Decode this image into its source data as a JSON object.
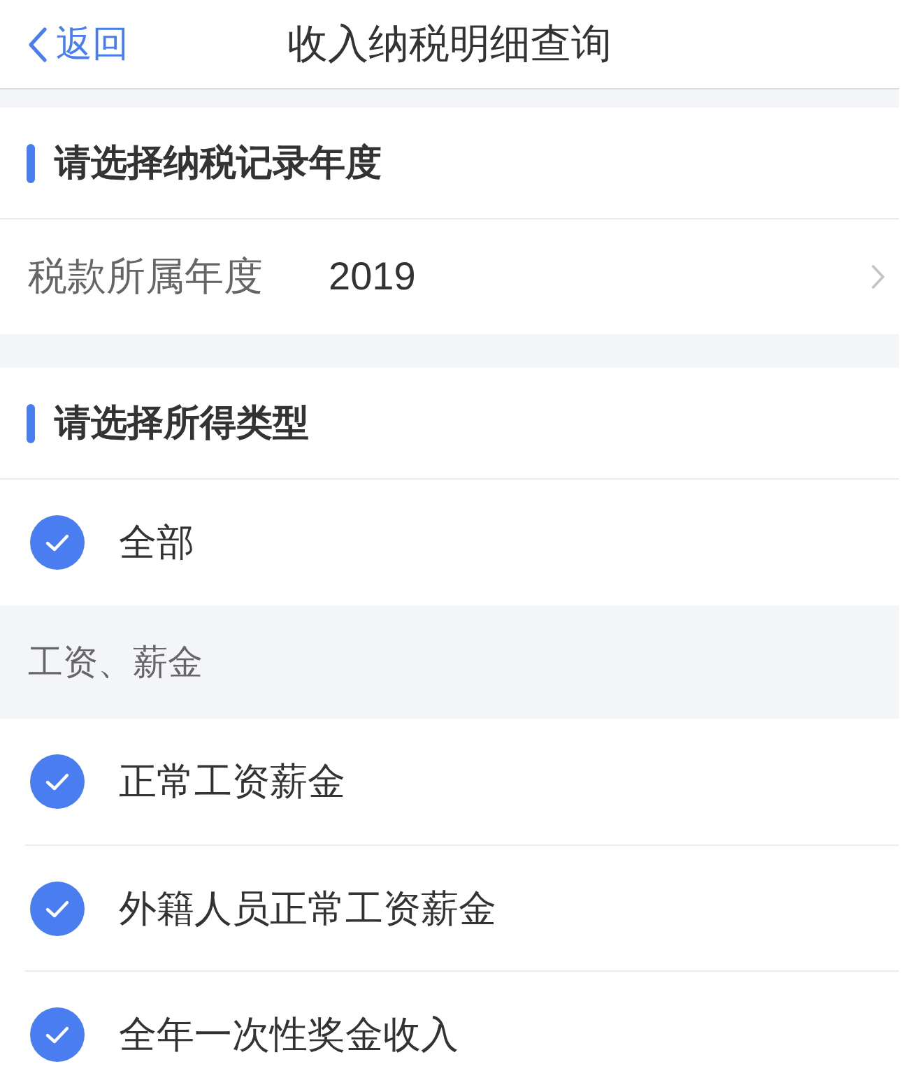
{
  "nav": {
    "back": "返回",
    "title": "收入纳税明细查询"
  },
  "year_section": {
    "heading": "请选择纳税记录年度",
    "field_label": "税款所属年度",
    "field_value": "2019"
  },
  "type_section": {
    "heading": "请选择所得类型",
    "items": [
      {
        "kind": "option",
        "label": "全部",
        "checked": true
      },
      {
        "kind": "category",
        "label": "工资、薪金"
      },
      {
        "kind": "option",
        "label": "正常工资薪金",
        "checked": true
      },
      {
        "kind": "option",
        "label": "外籍人员正常工资薪金",
        "checked": true
      },
      {
        "kind": "option",
        "label": "全年一次性奖金收入",
        "checked": true
      }
    ]
  }
}
